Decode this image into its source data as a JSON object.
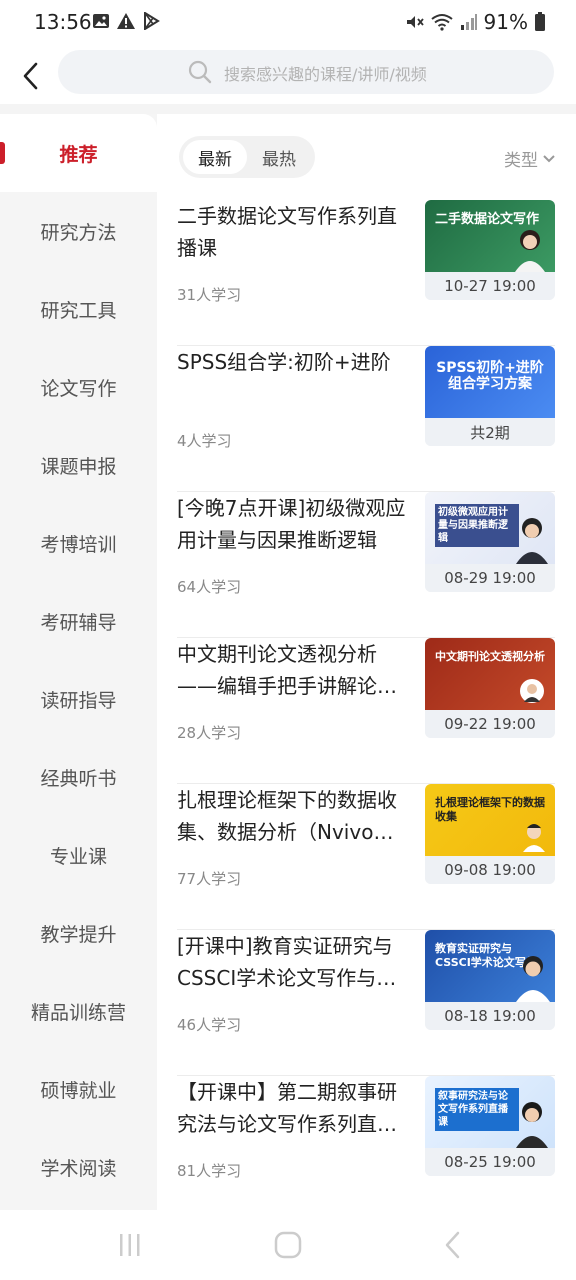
{
  "status": {
    "time": "13:56",
    "battery": "91%"
  },
  "header": {
    "search_placeholder": "搜索感兴趣的课程/讲师/视频"
  },
  "sidebar": {
    "items": [
      {
        "label": "推荐",
        "active": true
      },
      {
        "label": "研究方法"
      },
      {
        "label": "研究工具"
      },
      {
        "label": "论文写作"
      },
      {
        "label": "课题申报"
      },
      {
        "label": "考博培训"
      },
      {
        "label": "考研辅导"
      },
      {
        "label": "读研指导"
      },
      {
        "label": "经典听书"
      },
      {
        "label": "专业课"
      },
      {
        "label": "教学提升"
      },
      {
        "label": "精品训练营"
      },
      {
        "label": "硕博就业"
      },
      {
        "label": "学术阅读"
      }
    ]
  },
  "sort": {
    "newest": "最新",
    "hottest": "最热",
    "type_label": "类型"
  },
  "courses": [
    {
      "title": "二手数据论文写作系列直播课",
      "count": "31人学习",
      "caption": "10-27 19:00",
      "thumb_text": "二手数据论文写作",
      "thumb_color": "#2e7d4f"
    },
    {
      "title": "SPSS组合学:初阶+进阶",
      "count": "4人学习",
      "caption": "共2期",
      "thumb_text": "SPSS初阶+进阶 组合学习方案",
      "thumb_color": "#2f6fe0"
    },
    {
      "title": "[今晚7点开课]初级微观应用计量与因果推断逻辑",
      "count": "64人学习",
      "caption": "08-29 19:00",
      "thumb_text": "初级微观应用计量与因果推断逻辑",
      "thumb_color": "#3a4f8f"
    },
    {
      "title": "中文期刊论文透视分析——编辑手把手讲解论文写作",
      "count": "28人学习",
      "caption": "09-22 19:00",
      "thumb_text": "中文期刊论文透视分析",
      "thumb_color": "#a8321f"
    },
    {
      "title": "扎根理论框架下的数据收集、数据分析（Nvivo使用）及学术写作",
      "count": "77人学习",
      "caption": "09-08 19:00",
      "thumb_text": "扎根理论框架下的数据收集",
      "thumb_color": "#f2c21b"
    },
    {
      "title": "[开课中]教育实证研究与CSSCI学术论文写作与发表",
      "count": "46人学习",
      "caption": "08-18 19:00",
      "thumb_text": "教育实证研究与CSSCI学术论文写作",
      "thumb_color": "#2b5fb8"
    },
    {
      "title": "【开课中】第二期叙事研究法与论文写作系列直播课",
      "count": "81人学习",
      "caption": "08-25 19:00",
      "thumb_text": "叙事研究法与论文写作系列直播课",
      "thumb_color": "#1c6fcf"
    }
  ]
}
